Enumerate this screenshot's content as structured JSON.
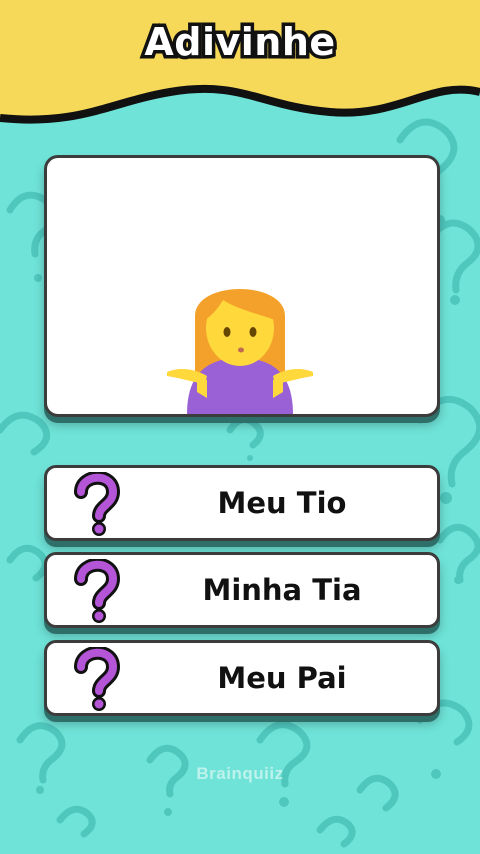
{
  "header": {
    "title": "Adivinhe"
  },
  "quiz": {
    "image_icon": "woman-shrugging-icon",
    "options": [
      {
        "label": "Meu Tio",
        "icon": "question-mark-icon"
      },
      {
        "label": "Minha Tia",
        "icon": "question-mark-icon"
      },
      {
        "label": "Meu Pai",
        "icon": "question-mark-icon"
      }
    ]
  },
  "watermark": "Brainquiiz",
  "colors": {
    "background": "#6fe3d8",
    "header": "#f7d959",
    "question_mark": "#b455d8",
    "card": "#ffffff"
  }
}
